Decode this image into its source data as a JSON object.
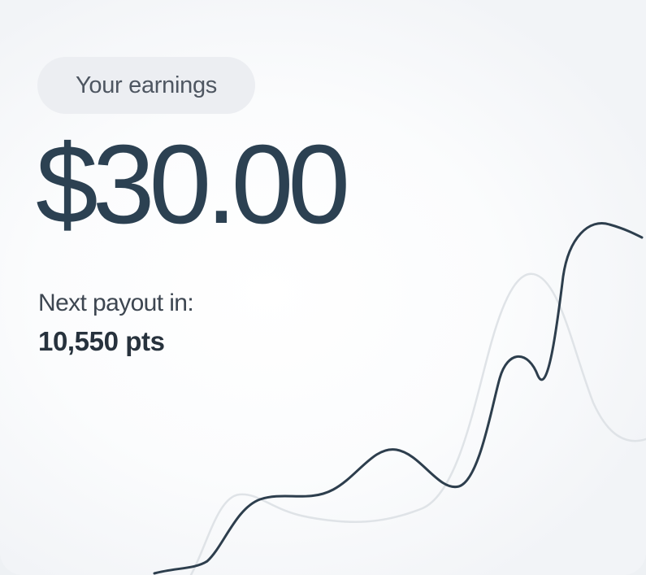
{
  "earnings": {
    "badge_label": "Your earnings",
    "amount": "$30.00"
  },
  "payout": {
    "label": "Next payout in:",
    "value": "10,550 pts"
  },
  "colors": {
    "primary_text": "#2c4152",
    "main_line": "#2d3e4d",
    "ghost_line": "#dfe3e7",
    "badge_bg": "#eceef2"
  }
}
